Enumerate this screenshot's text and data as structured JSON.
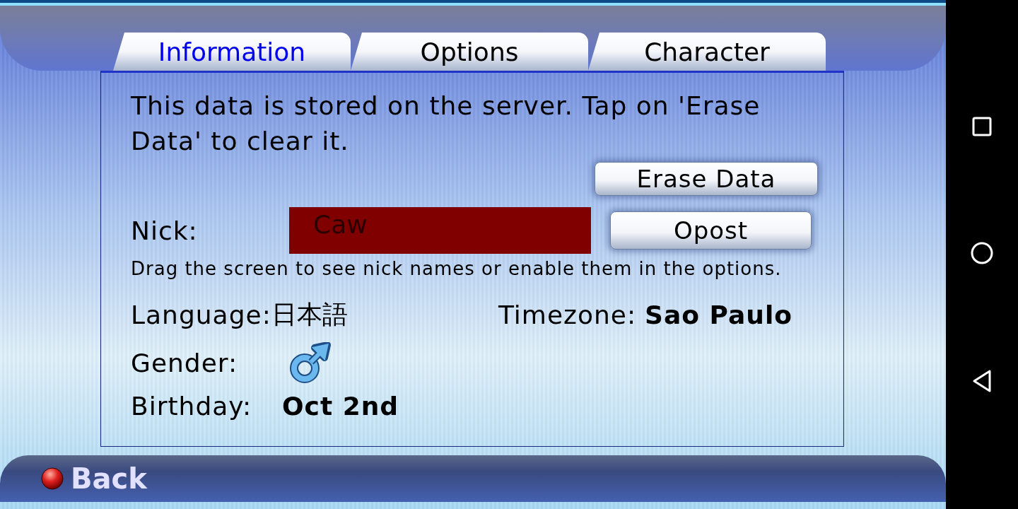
{
  "tabs": [
    {
      "label": "Information",
      "selected": true
    },
    {
      "label": "Options",
      "selected": false
    },
    {
      "label": "Character",
      "selected": false
    }
  ],
  "intro": "This data is stored on the server. Tap on 'Erase Data' to clear it.",
  "erase_button": "Erase Data",
  "nick": {
    "label": "Nick:",
    "value": "Caw",
    "button": "Opost"
  },
  "hint": "Drag the screen to see nick names or enable them in the options.",
  "language": {
    "label": "Language:",
    "value": "日本語"
  },
  "timezone": {
    "label": "Timezone:",
    "value": "Sao Paulo"
  },
  "gender": {
    "label": "Gender:"
  },
  "birthday": {
    "label": "Birthday:",
    "value": "Oct 2nd"
  },
  "back_button": "Back"
}
